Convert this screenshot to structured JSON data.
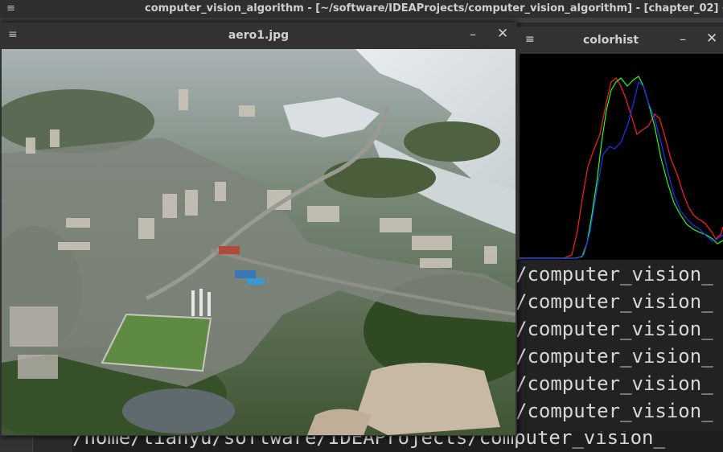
{
  "ide": {
    "menu_glyph": "≡",
    "title": "computer_vision_algorithm - [~/software/IDEAProjects/computer_vision_algorithm] - [chapter_02] -"
  },
  "aero_window": {
    "menu_glyph": "≡",
    "title": "aero1.jpg",
    "minimize_glyph": "–",
    "close_glyph": "✕"
  },
  "hist_window": {
    "menu_glyph": "≡",
    "title": "colorhist",
    "minimize_glyph": "–",
    "close_glyph": "✕"
  },
  "terminal": {
    "lines": [
      "/computer_vision_",
      "/computer_vision_",
      "/computer_vision_",
      "/computer_vision_",
      "/computer_vision_",
      "/computer_vision_"
    ],
    "bottom_line": "/home/tianyu/software/IDEAProjects/computer_vision_"
  },
  "histogram": {
    "colors": {
      "red": "#ff2020",
      "green": "#20ff20",
      "blue": "#2030ff"
    }
  }
}
